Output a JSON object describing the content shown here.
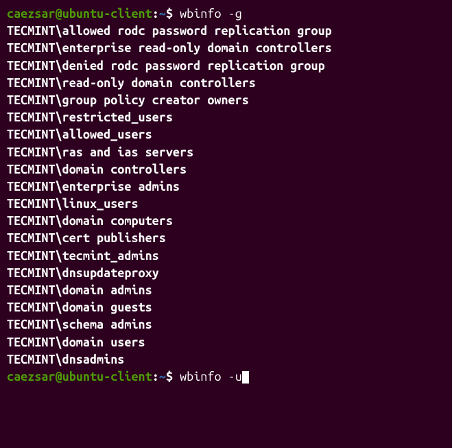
{
  "prompt": {
    "user": "caezsar",
    "at": "@",
    "host": "ubuntu-client",
    "separator": ":",
    "path": "~",
    "dollar": "$ "
  },
  "command1": "wbinfo -g",
  "output": [
    "TECMINT\\allowed rodc password replication group",
    "TECMINT\\enterprise read-only domain controllers",
    "TECMINT\\denied rodc password replication group",
    "TECMINT\\read-only domain controllers",
    "TECMINT\\group policy creator owners",
    "TECMINT\\restricted_users",
    "TECMINT\\allowed_users",
    "TECMINT\\ras and ias servers",
    "TECMINT\\domain controllers",
    "TECMINT\\enterprise admins",
    "TECMINT\\linux_users",
    "TECMINT\\domain computers",
    "TECMINT\\cert publishers",
    "TECMINT\\tecmint_admins",
    "TECMINT\\dnsupdateproxy",
    "TECMINT\\domain admins",
    "TECMINT\\domain guests",
    "TECMINT\\schema admins",
    "TECMINT\\domain users",
    "TECMINT\\dnsadmins"
  ],
  "command2": "wbinfo -u"
}
